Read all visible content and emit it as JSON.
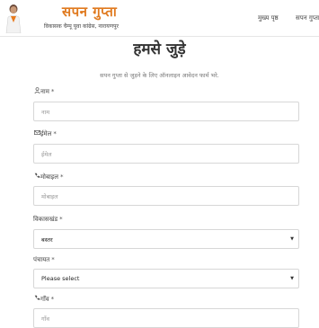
{
  "header": {
    "brand_title": "सपन गुप्ता",
    "brand_subtitle": "विकासक चैम्पू युवा कांग्रेस, नारायणपुर",
    "nav": {
      "home": "मुख्य पृष्ठ",
      "about": "सपन गुप्ता"
    }
  },
  "main": {
    "title": "हमसे जुड़े",
    "intro": "सपन गुप्ता से जुड़ने के लिए ऑनलाइन आवेदन फार्म भरे.",
    "fields": {
      "name": {
        "label": "नाम",
        "required": "*",
        "placeholder": "नाम"
      },
      "email": {
        "label": "ईमेल",
        "required": "*",
        "placeholder": "ईमेल"
      },
      "mobile": {
        "label": "मोबाइल",
        "required": "*",
        "placeholder": "मोबाइल"
      },
      "block": {
        "label": "विकासखंड",
        "required": "*",
        "value": "बस्तर"
      },
      "panchayat": {
        "label": "पंचायत",
        "required": "*",
        "value": "Please select"
      },
      "village": {
        "label": "गाँव",
        "required": "*",
        "placeholder": "गाँव"
      }
    }
  },
  "icons": {
    "name": "user-icon",
    "email": "envelope-icon",
    "mobile": "phone-icon",
    "village": "phone-icon",
    "dropdown": "caret-down-icon"
  }
}
